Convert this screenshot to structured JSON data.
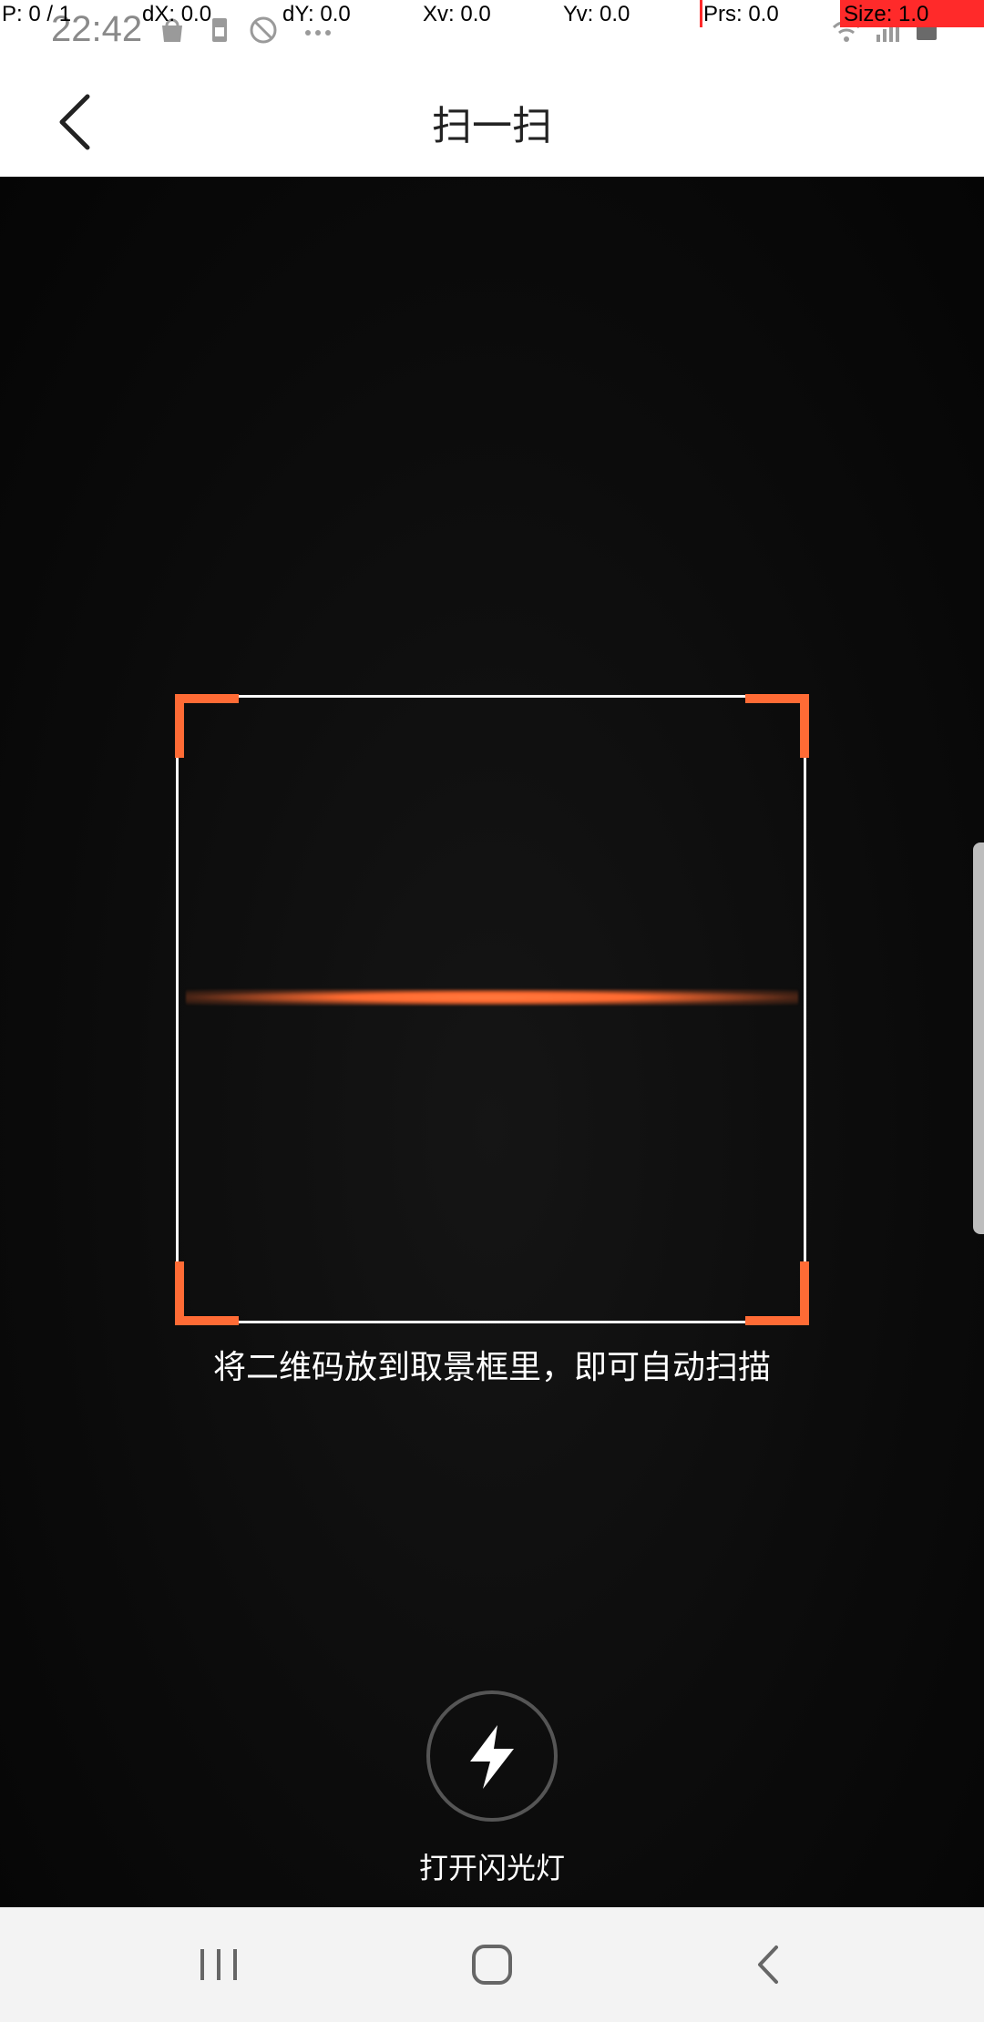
{
  "status_bar": {
    "time": "22:42",
    "icons": [
      "bag-icon",
      "sim-icon",
      "blocked-icon",
      "more-icon",
      "wifi-icon",
      "signal-icon",
      "battery-icon"
    ]
  },
  "pointer_overlay": {
    "p": "P: 0 / 1",
    "dx": "dX: 0.0",
    "dy": "dY: 0.0",
    "xv": "Xv: 0.0",
    "yv": "Yv: 0.0",
    "prs": "Prs: 0.0",
    "size": "Size: 1.0"
  },
  "header": {
    "title": "扫一扫"
  },
  "scanner": {
    "hint": "将二维码放到取景框里，即可自动扫描",
    "accent_color": "#ff6b35"
  },
  "flash": {
    "label": "打开闪光灯"
  },
  "nav": {
    "icons": [
      "recents-icon",
      "home-icon",
      "back-icon"
    ]
  }
}
